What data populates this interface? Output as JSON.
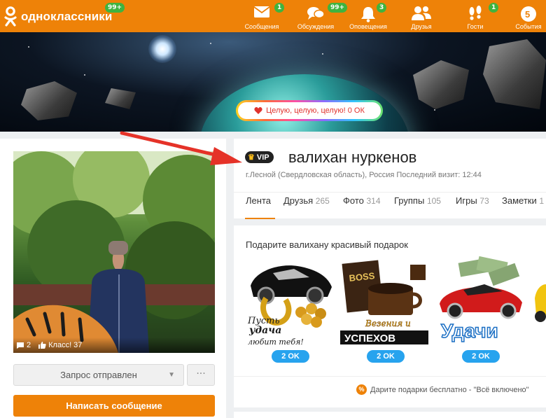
{
  "header": {
    "logo_text": "одноклассники",
    "logo_badge": "99+",
    "nav": [
      {
        "label": "Сообщения",
        "badge": "1",
        "icon": "envelope-icon"
      },
      {
        "label": "Обсуждения",
        "badge": "99+",
        "icon": "chat-bubbles-icon"
      },
      {
        "label": "Оповещения",
        "badge": "3",
        "icon": "bell-icon"
      },
      {
        "label": "Друзья",
        "badge": "",
        "icon": "friends-icon"
      },
      {
        "label": "Гости",
        "badge": "1",
        "icon": "footprints-icon"
      },
      {
        "label": "События",
        "badge": "",
        "icon": "events-icon",
        "icon_text": "5"
      }
    ],
    "accent_color": "#ee8208",
    "badge_color": "#3fb33f"
  },
  "cover": {
    "status_text": "Целую, целую, целую! 0 ОК"
  },
  "profile": {
    "vip_label": "VIP",
    "name": "валихан нуркенов",
    "location": "г.Лесной (Свердловская область), Россия",
    "last_visit": "Последний визит: 12:44",
    "photo_comments": "2",
    "photo_likes": "Класс! 37",
    "request_button": "Запрос отправлен",
    "more_button": "···",
    "message_button": "Написать сообщение"
  },
  "tabs": [
    {
      "label": "Лента",
      "count": ""
    },
    {
      "label": "Друзья",
      "count": "265"
    },
    {
      "label": "Фото",
      "count": "314"
    },
    {
      "label": "Группы",
      "count": "105"
    },
    {
      "label": "Игры",
      "count": "73"
    },
    {
      "label": "Заметки",
      "count": "1"
    }
  ],
  "gifts": {
    "title": "Подарите валихану красивый подарок",
    "items": [
      {
        "caption": "Пусть удача любит тебя!",
        "price": "2 OK"
      },
      {
        "caption": "Везения и успехов",
        "price": "2 OK"
      },
      {
        "caption": "Удачи",
        "price": "2 OK"
      }
    ],
    "footer": "Дарите подарки бесплатно - \"Всё включено\""
  },
  "gift_card_text": {
    "boss": "BOSS",
    "vezenia": "Везения и",
    "uspehov": "УСПЕХОВ",
    "pust": "Пусть",
    "udacha": "удача",
    "lyubit": "любит тебя!",
    "udachi": "Удачи"
  }
}
